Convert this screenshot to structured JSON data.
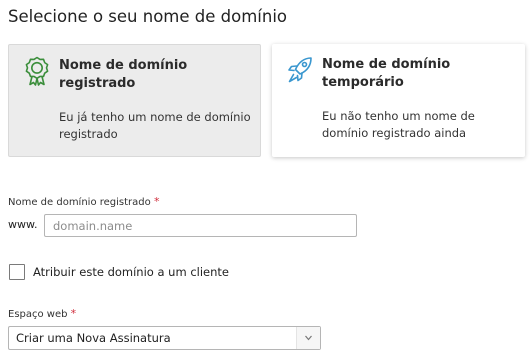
{
  "page": {
    "title": "Selecione o seu nome de domínio"
  },
  "domain_type": {
    "options": [
      {
        "title": "Nome de domínio registrado",
        "description": "Eu já tenho um nome de domínio registrado",
        "icon": "award-ribbon-icon",
        "selected": true
      },
      {
        "title": "Nome de domínio temporário",
        "description": "Eu não tenho um nome de domínio registrado ainda",
        "icon": "rocket-icon",
        "selected": false
      }
    ]
  },
  "domain_field": {
    "label": "Nome de domínio registrado",
    "required_mark": "*",
    "prefix": "www.",
    "value": "",
    "placeholder": "domain.name"
  },
  "assign_client": {
    "label": "Atribuir este domínio a um cliente",
    "checked": false
  },
  "webspace_field": {
    "label": "Espaço web",
    "required_mark": "*",
    "selected_value": "Criar uma Nova Assinatura"
  },
  "colors": {
    "accent_icon": "#3b8e3b",
    "rocket_icon": "#3a97cf",
    "required": "#d02e3c",
    "selected_card_bg": "#ececec"
  }
}
